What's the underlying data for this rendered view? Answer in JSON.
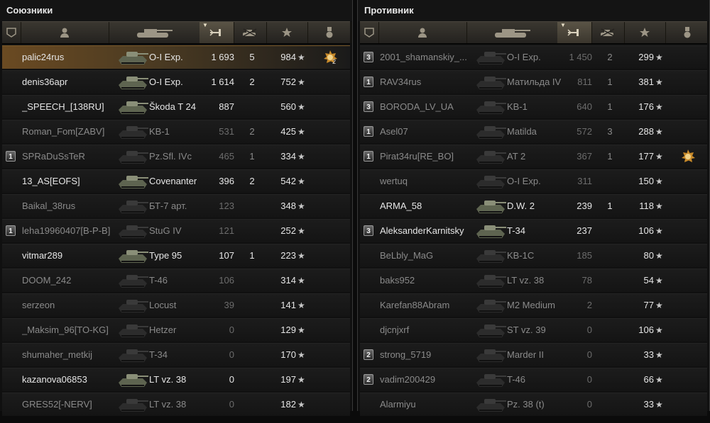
{
  "colors": {
    "accent": "#f0a020",
    "player_highlight": "#6a4a22",
    "alive_text": "#e6e6e6",
    "dead_text": "#8a8a8a"
  },
  "header_icons": [
    "badge-icon",
    "player-icon",
    "tank-icon",
    "damage-icon",
    "kills-icon",
    "experience-star-icon",
    "medal-icon"
  ],
  "left": {
    "title": "Союзники",
    "rows": [
      {
        "badge": "",
        "player": "palic24rus",
        "tank": "O-I Exp.",
        "damage": "1 693",
        "kills": "5",
        "xp": "984",
        "alive": true,
        "me": true,
        "medal": true,
        "medal_count": "2"
      },
      {
        "badge": "",
        "player": "denis36apr",
        "tank": "O-I Exp.",
        "damage": "1 614",
        "kills": "2",
        "xp": "752",
        "alive": true
      },
      {
        "badge": "",
        "player": "_SPEECH_[138RU]",
        "tank": "Škoda T 24",
        "damage": "887",
        "kills": "",
        "xp": "560",
        "alive": true
      },
      {
        "badge": "",
        "player": "Roman_Fom[ZABV]",
        "tank": "KB-1",
        "damage": "531",
        "kills": "2",
        "xp": "425",
        "alive": false
      },
      {
        "badge": "1",
        "player": "SPRaDuSsTeR",
        "tank": "Pz.Sfl. IVc",
        "damage": "465",
        "kills": "1",
        "xp": "334",
        "alive": false
      },
      {
        "badge": "",
        "player": "13_AS[EOFS]",
        "tank": "Covenanter",
        "damage": "396",
        "kills": "2",
        "xp": "542",
        "alive": true
      },
      {
        "badge": "",
        "player": "Baikal_38rus",
        "tank": "БТ-7 арт.",
        "damage": "123",
        "kills": "",
        "xp": "348",
        "alive": false
      },
      {
        "badge": "1",
        "player": "leha19960407[B-P-B]",
        "tank": "StuG IV",
        "damage": "121",
        "kills": "",
        "xp": "252",
        "alive": false
      },
      {
        "badge": "",
        "player": "vitmar289",
        "tank": "Type 95",
        "damage": "107",
        "kills": "1",
        "xp": "223",
        "alive": true
      },
      {
        "badge": "",
        "player": "DOOM_242",
        "tank": "T-46",
        "damage": "106",
        "kills": "",
        "xp": "314",
        "alive": false
      },
      {
        "badge": "",
        "player": "serzeon",
        "tank": "Locust",
        "damage": "39",
        "kills": "",
        "xp": "141",
        "alive": false
      },
      {
        "badge": "",
        "player": "_Maksim_96[TO-KG]",
        "tank": "Hetzer",
        "damage": "0",
        "kills": "",
        "xp": "129",
        "alive": false
      },
      {
        "badge": "",
        "player": "shumaher_metkij",
        "tank": "T-34",
        "damage": "0",
        "kills": "",
        "xp": "170",
        "alive": false
      },
      {
        "badge": "",
        "player": "kazanova06853",
        "tank": "LT vz. 38",
        "damage": "0",
        "kills": "",
        "xp": "197",
        "alive": true
      },
      {
        "badge": "",
        "player": "GRES52[-NERV]",
        "tank": "LT vz. 38",
        "damage": "0",
        "kills": "",
        "xp": "182",
        "alive": false
      }
    ]
  },
  "right": {
    "title": "Противник",
    "rows": [
      {
        "badge": "3",
        "player": "2001_shamanskiy_...",
        "tank": "O-I Exp.",
        "damage": "1 450",
        "kills": "2",
        "xp": "299",
        "alive": false
      },
      {
        "badge": "1",
        "player": "RAV34rus",
        "tank": "Матильда IV",
        "damage": "811",
        "kills": "1",
        "xp": "381",
        "alive": false
      },
      {
        "badge": "3",
        "player": "BORODA_LV_UA",
        "tank": "KB-1",
        "damage": "640",
        "kills": "1",
        "xp": "176",
        "alive": false
      },
      {
        "badge": "1",
        "player": "Asel07",
        "tank": "Matilda",
        "damage": "572",
        "kills": "3",
        "xp": "288",
        "alive": false
      },
      {
        "badge": "1",
        "player": "Pirat34ru[RE_BO]",
        "tank": "AT 2",
        "damage": "367",
        "kills": "1",
        "xp": "177",
        "alive": false,
        "medal": true
      },
      {
        "badge": "",
        "player": "wertuq",
        "tank": "O-I Exp.",
        "damage": "311",
        "kills": "",
        "xp": "150",
        "alive": false
      },
      {
        "badge": "",
        "player": "ARMA_58",
        "tank": "D.W. 2",
        "damage": "239",
        "kills": "1",
        "xp": "118",
        "alive": true
      },
      {
        "badge": "3",
        "player": "AleksanderKarnitsky",
        "tank": "T-34",
        "damage": "237",
        "kills": "",
        "xp": "106",
        "alive": true
      },
      {
        "badge": "",
        "player": "BeLbly_MaG",
        "tank": "KB-1C",
        "damage": "185",
        "kills": "",
        "xp": "80",
        "alive": false
      },
      {
        "badge": "",
        "player": "baks952",
        "tank": "LT vz. 38",
        "damage": "78",
        "kills": "",
        "xp": "54",
        "alive": false
      },
      {
        "badge": "",
        "player": "Karefan88Abram",
        "tank": "M2 Medium",
        "damage": "2",
        "kills": "",
        "xp": "77",
        "alive": false
      },
      {
        "badge": "",
        "player": "djcnjxrf",
        "tank": "ST vz. 39",
        "damage": "0",
        "kills": "",
        "xp": "106",
        "alive": false
      },
      {
        "badge": "2",
        "player": "strong_5719",
        "tank": "Marder II",
        "damage": "0",
        "kills": "",
        "xp": "33",
        "alive": false
      },
      {
        "badge": "2",
        "player": "vadim200429",
        "tank": "T-46",
        "damage": "0",
        "kills": "",
        "xp": "66",
        "alive": false
      },
      {
        "badge": "",
        "player": "Alarmiyu",
        "tank": "Pz. 38 (t)",
        "damage": "0",
        "kills": "",
        "xp": "33",
        "alive": false
      }
    ]
  }
}
